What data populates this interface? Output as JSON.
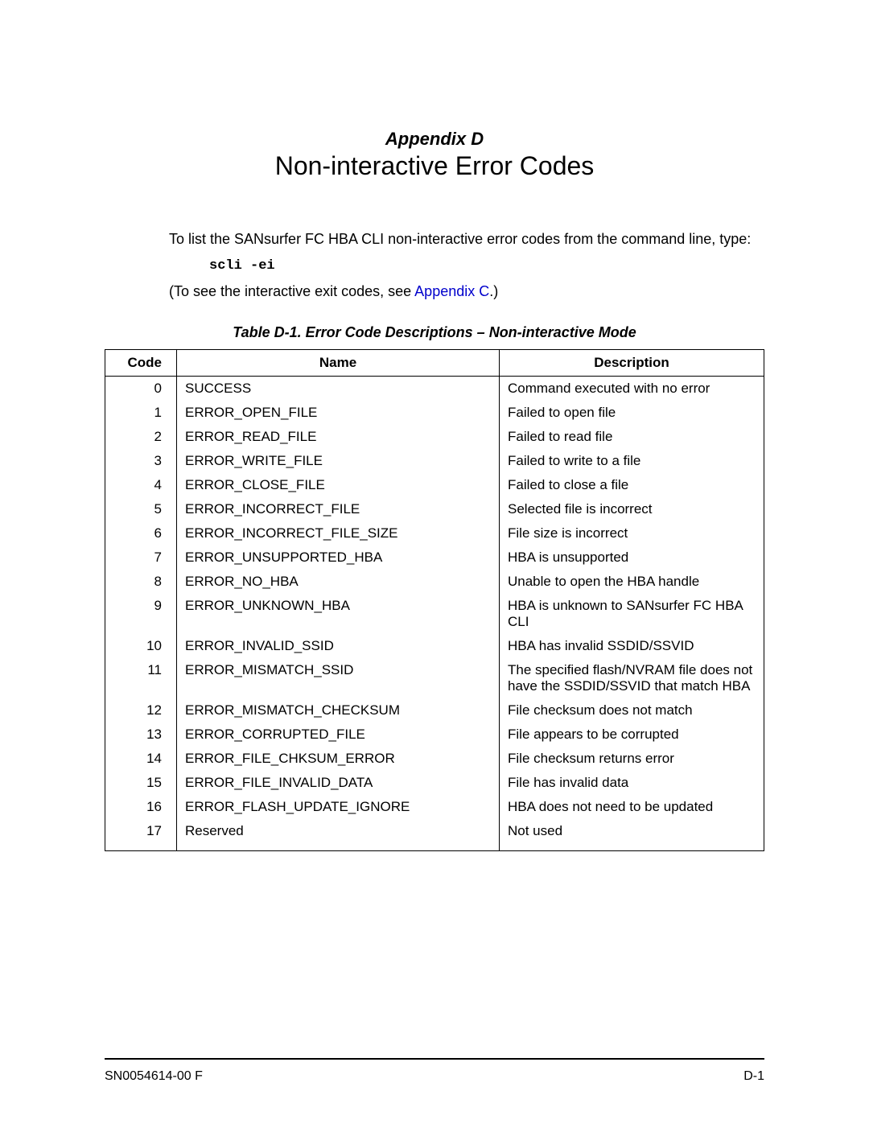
{
  "header": {
    "appendix_label": "Appendix D",
    "title": "Non-interactive Error Codes"
  },
  "intro_text": "To list the SANsurfer FC HBA CLI non-interactive error codes from the command line, type:",
  "command": "scli -ei",
  "see_also_prefix": "(To see the interactive exit codes, see ",
  "see_also_link": "Appendix C",
  "see_also_suffix": ".)",
  "table_caption": "Table D-1. Error Code Descriptions – Non-interactive Mode",
  "columns": {
    "code": "Code",
    "name": "Name",
    "description": "Description"
  },
  "rows": [
    {
      "code": "0",
      "name": "SUCCESS",
      "desc": "Command executed with no error"
    },
    {
      "code": "1",
      "name": "ERROR_OPEN_FILE",
      "desc": "Failed to open file"
    },
    {
      "code": "2",
      "name": "ERROR_READ_FILE",
      "desc": "Failed to read file"
    },
    {
      "code": "3",
      "name": "ERROR_WRITE_FILE",
      "desc": "Failed to write to a file"
    },
    {
      "code": "4",
      "name": "ERROR_CLOSE_FILE",
      "desc": "Failed to close a file"
    },
    {
      "code": "5",
      "name": "ERROR_INCORRECT_FILE",
      "desc": "Selected file is incorrect"
    },
    {
      "code": "6",
      "name": "ERROR_INCORRECT_FILE_SIZE",
      "desc": "File size is incorrect"
    },
    {
      "code": "7",
      "name": "ERROR_UNSUPPORTED_HBA",
      "desc": "HBA is unsupported"
    },
    {
      "code": "8",
      "name": "ERROR_NO_HBA",
      "desc": "Unable to open the HBA handle"
    },
    {
      "code": "9",
      "name": "ERROR_UNKNOWN_HBA",
      "desc": "HBA is unknown to SANsurfer FC HBA CLI"
    },
    {
      "code": "10",
      "name": "ERROR_INVALID_SSID",
      "desc": "HBA has invalid SSDID/SSVID"
    },
    {
      "code": "11",
      "name": "ERROR_MISMATCH_SSID",
      "desc": "The specified flash/NVRAM file does not have the SSDID/SSVID that match HBA"
    },
    {
      "code": "12",
      "name": "ERROR_MISMATCH_CHECKSUM",
      "desc": "File checksum does not match"
    },
    {
      "code": "13",
      "name": "ERROR_CORRUPTED_FILE",
      "desc": "File appears to be corrupted"
    },
    {
      "code": "14",
      "name": "ERROR_FILE_CHKSUM_ERROR",
      "desc": "File checksum returns error"
    },
    {
      "code": "15",
      "name": "ERROR_FILE_INVALID_DATA",
      "desc": "File has invalid data"
    },
    {
      "code": "16",
      "name": "ERROR_FLASH_UPDATE_IGNORE",
      "desc": "HBA does not need to be updated"
    },
    {
      "code": "17",
      "name": "Reserved",
      "desc": "Not used"
    }
  ],
  "footer": {
    "left": "SN0054614-00  F",
    "right": "D-1"
  }
}
